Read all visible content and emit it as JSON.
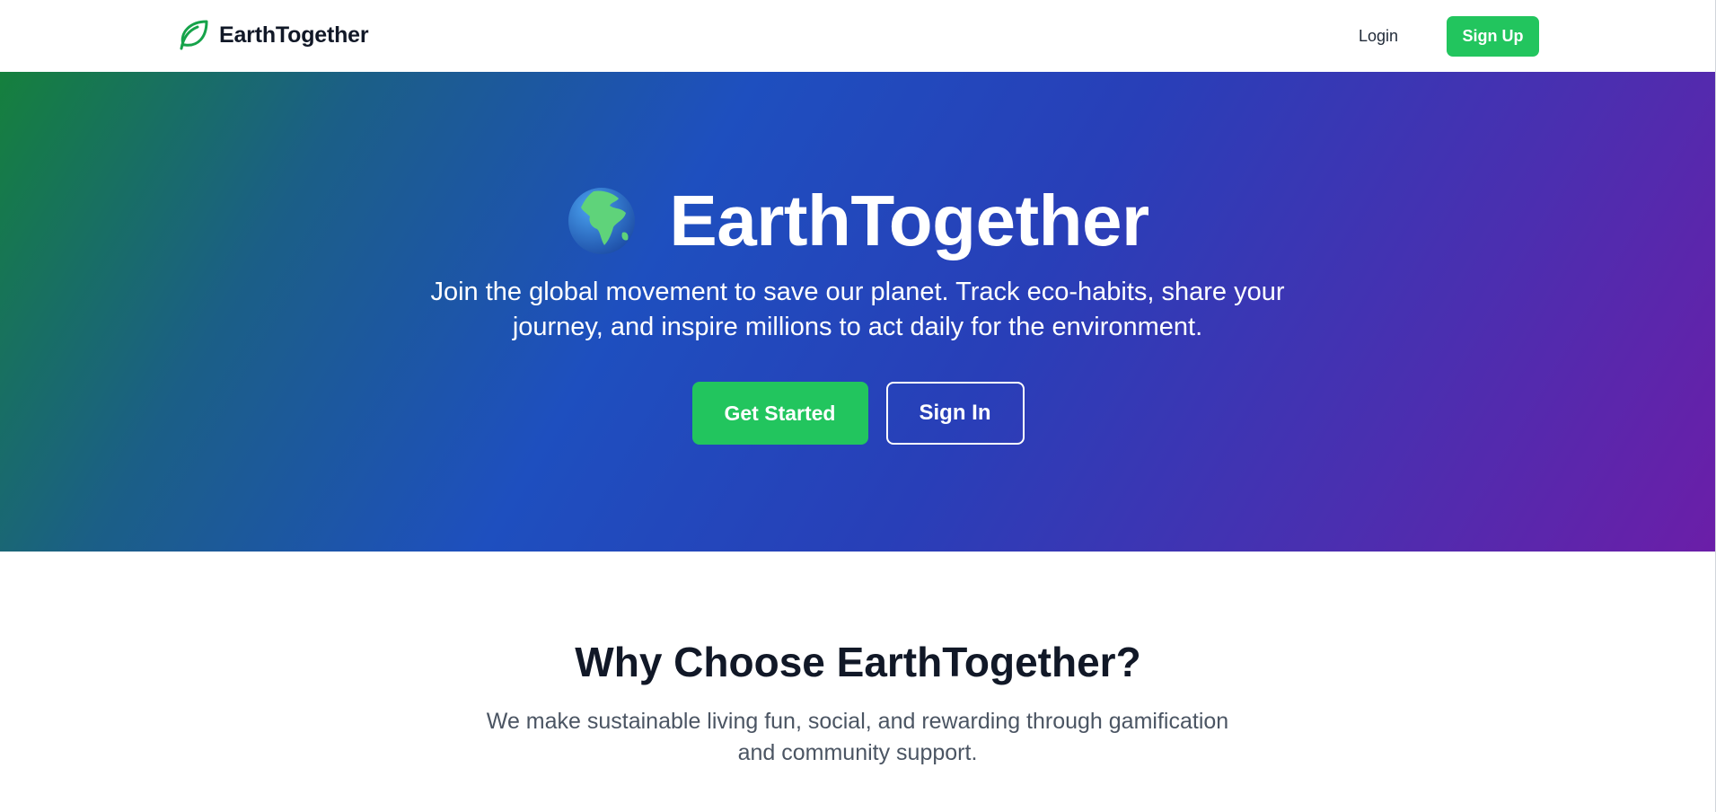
{
  "nav": {
    "brand": "EarthTogether",
    "login": "Login",
    "signup": "Sign Up"
  },
  "hero": {
    "title": "EarthTogether",
    "subtitle": "Join the global movement to save our planet. Track eco-habits, share your journey, and inspire millions to act daily for the environment.",
    "primary_cta": "Get Started",
    "secondary_cta": "Sign In"
  },
  "why": {
    "title": "Why Choose EarthTogether?",
    "subtitle": "We make sustainable living fun, social, and rewarding through gamification and community support."
  },
  "icons": {
    "brand": "leaf-icon",
    "hero": "globe-icon"
  },
  "colors": {
    "accent": "#22c55e",
    "text": "#111827"
  }
}
